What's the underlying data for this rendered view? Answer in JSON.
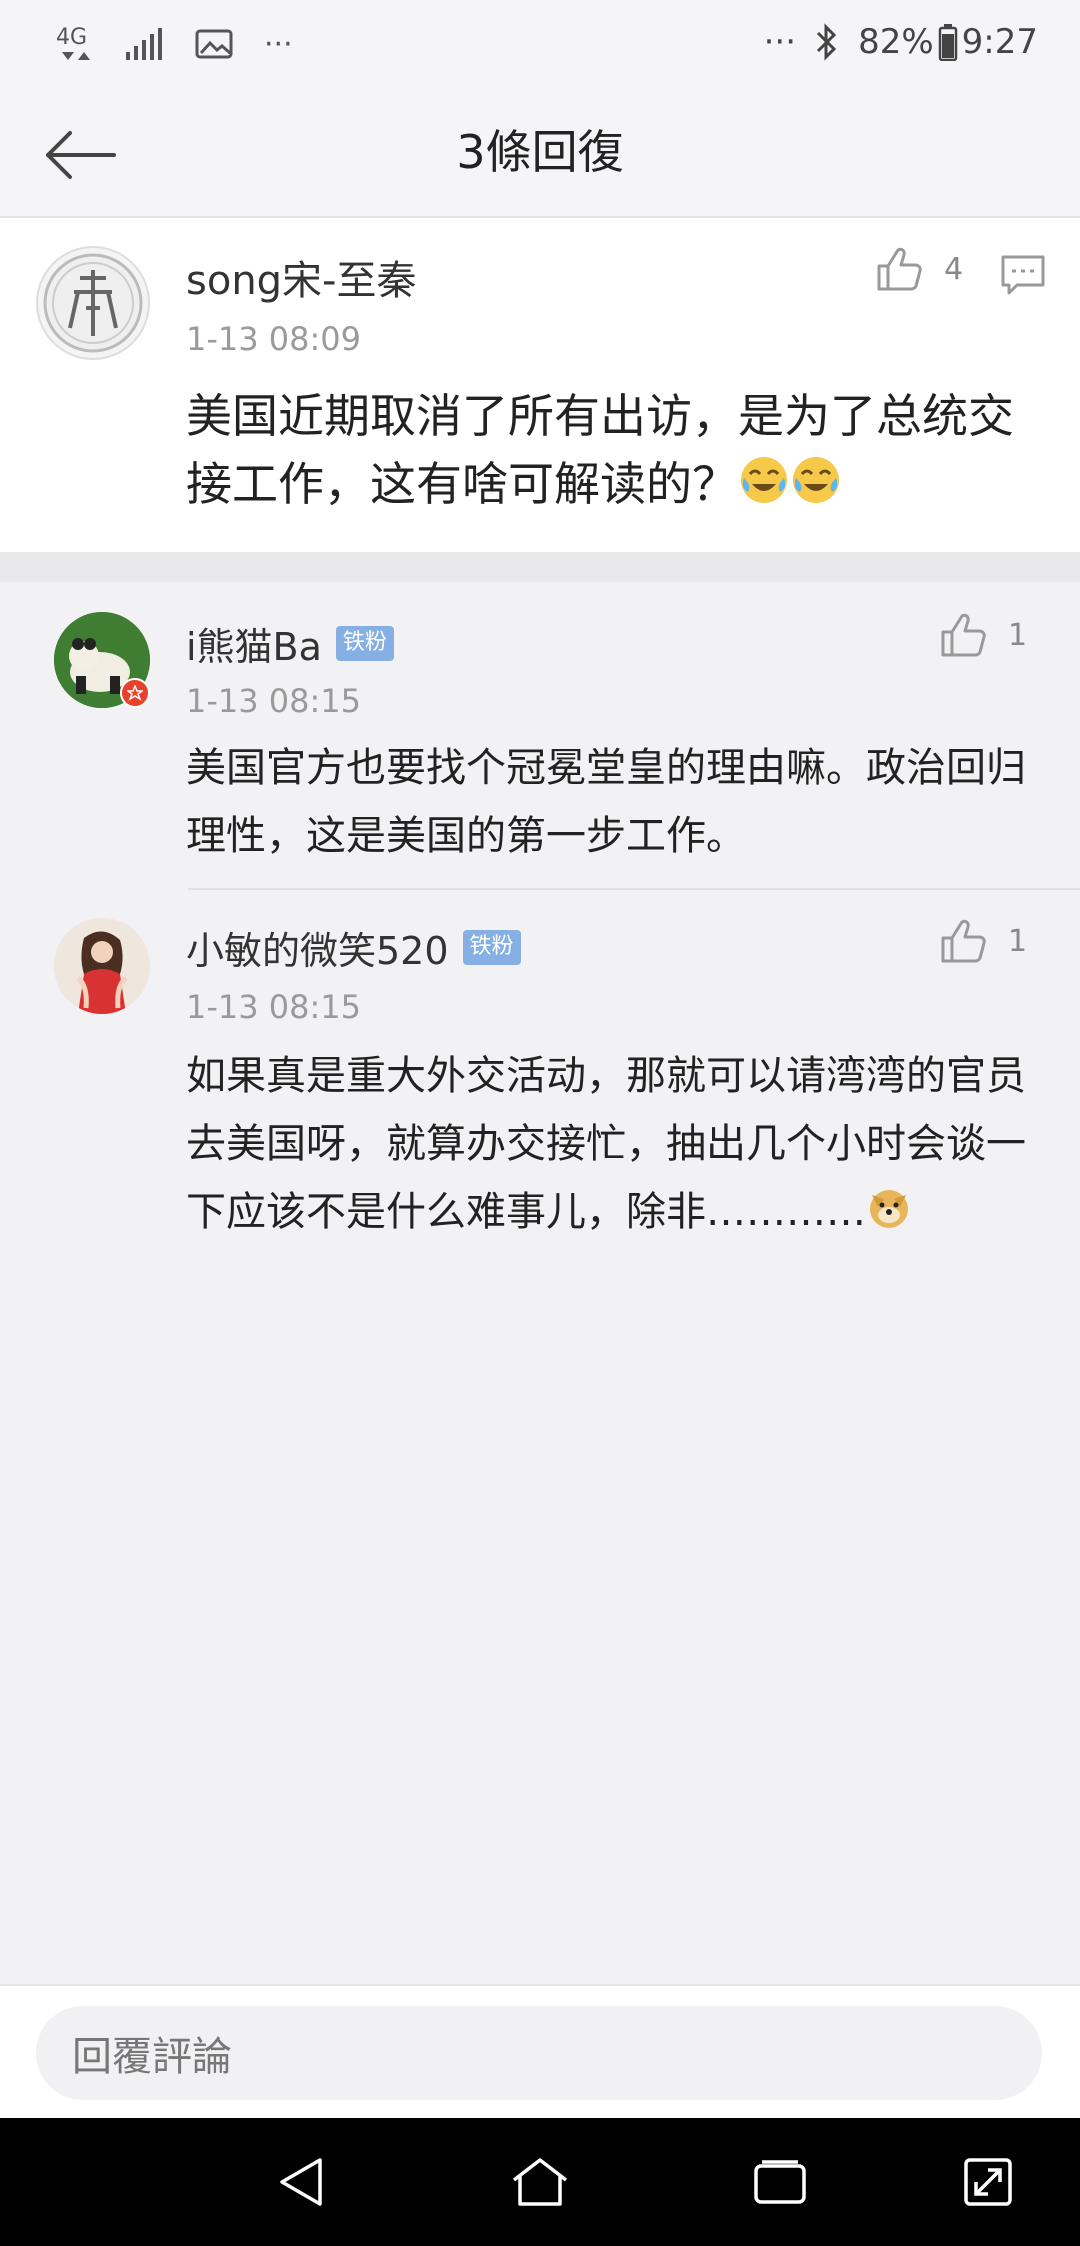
{
  "status_bar": {
    "network": "4G",
    "more_left": "···",
    "more_right": "···",
    "battery": "82%",
    "time": "9:27"
  },
  "header": {
    "title": "3條回復"
  },
  "main_comment": {
    "user": "song宋-至秦",
    "time": "1-13 08:09",
    "likes": "4",
    "text": "美国近期取消了所有出访，是为了总统交接工作，这有啥可解读的？"
  },
  "replies": [
    {
      "user": "i熊猫Ba",
      "badge": "铁粉",
      "time": "1-13 08:15",
      "likes": "1",
      "text": "美国官方也要找个冠冕堂皇的理由嘛。政治回归理性，这是美国的第一步工作。"
    },
    {
      "user": "小敏的微笑520",
      "badge": "铁粉",
      "time": "1-13 08:15",
      "likes": "1",
      "text": "如果真是重大外交活动，那就可以请湾湾的官员去美国呀，就算办交接忙，抽出几个小时会谈一下应该不是什么难事儿，除非…………"
    }
  ],
  "input": {
    "placeholder": "回覆評論"
  },
  "colors": {
    "badge": "#86b0e4",
    "secondary_text": "#9a9a9a"
  }
}
